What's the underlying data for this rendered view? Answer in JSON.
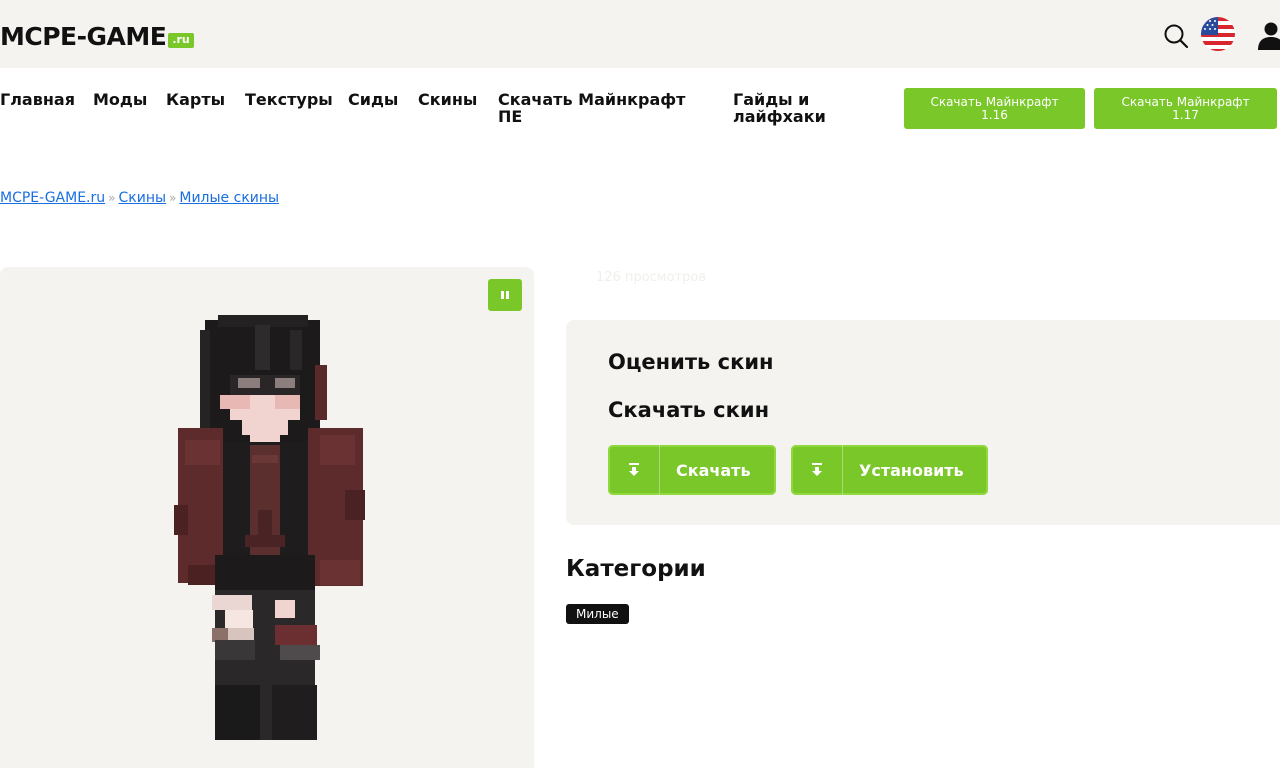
{
  "header": {
    "logo_main": "MCPE-GAME",
    "logo_tld": ".ru"
  },
  "nav": {
    "items": [
      "Главная",
      "Моды",
      "Карты",
      "Текстуры",
      "Сиды",
      "Скины",
      "Скачать Майнкрафт ПЕ",
      "Гайды и лайфхаки"
    ],
    "download_buttons": [
      {
        "line1": "Скачать Майнкрафт",
        "line2": "1.16"
      },
      {
        "line1": "Скачать Майнкрафт",
        "line2": "1.17"
      }
    ]
  },
  "breadcrumb": {
    "items": [
      "MCPE-GAME.ru",
      "Скины",
      "Милые скины"
    ],
    "separator": "»"
  },
  "skin": {
    "views": "126 просмотров"
  },
  "card": {
    "rate_title": "Оценить скин",
    "download_title": "Скачать скин",
    "download_label": "Скачать",
    "install_label": "Установить"
  },
  "categories": {
    "title": "Категории",
    "tags": [
      "Милые"
    ]
  },
  "colors": {
    "accent": "#7ac729",
    "panel_bg": "#f5f3ef",
    "link": "#1a6fe0"
  },
  "icons": {
    "search": "search-icon",
    "language": "us-flag-icon",
    "user": "user-icon",
    "pause": "pause-icon",
    "download": "download-arrow-icon"
  }
}
